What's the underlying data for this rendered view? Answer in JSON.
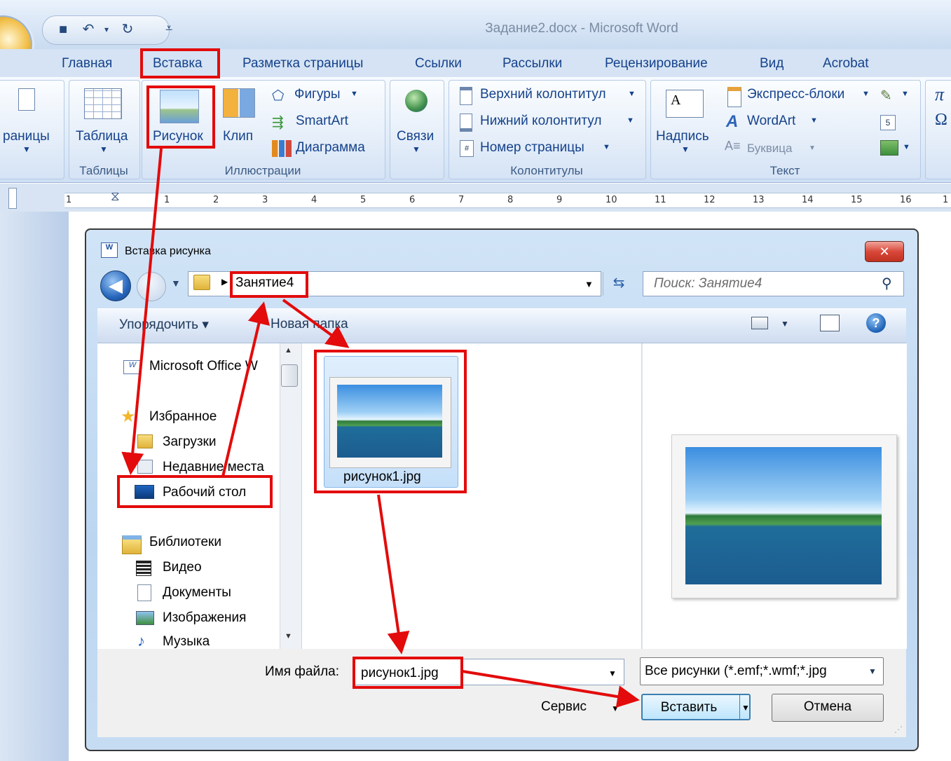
{
  "window": {
    "title": "Задание2.docx - Microsoft Word"
  },
  "tabs": [
    "Главная",
    "Вставка",
    "Разметка страницы",
    "Ссылки",
    "Рассылки",
    "Рецензирование",
    "Вид",
    "Acrobat"
  ],
  "ribbon": {
    "pages_label": "раницы",
    "table_label": "Таблица",
    "tables_group": "Таблицы",
    "picture_label": "Рисунок",
    "clip_label": "Клип",
    "shapes_label": "Фигуры",
    "smartart_label": "SmartArt",
    "chart_label": "Диаграмма",
    "illustrations_group": "Иллюстрации",
    "links_label": "Связи",
    "header_label": "Верхний колонтитул",
    "footer_label": "Нижний колонтитул",
    "pagenum_label": "Номер страницы",
    "headers_group": "Колонтитулы",
    "textbox_label": "Надпись",
    "quickparts_label": "Экспресс-блоки",
    "wordart_label": "WordArt",
    "dropcap_label": "Буквица",
    "text_group": "Текст",
    "pi_symbol": "π",
    "omega_symbol": "Ω"
  },
  "ruler": {
    "numbers": [
      "1",
      "1",
      "2",
      "3",
      "4",
      "5",
      "6",
      "7",
      "8",
      "9",
      "10",
      "11",
      "12",
      "13",
      "14",
      "15",
      "16",
      "1"
    ]
  },
  "dialog": {
    "title": "Вставка рисунка",
    "close": "✕",
    "address": "Занятие4",
    "search_placeholder": "Поиск: Занятие4",
    "organize": "Упорядочить ▾",
    "new_folder": "Новая папка",
    "nav": {
      "msoffice": "Microsoft Office W",
      "favorites": "Избранное",
      "downloads": "Загрузки",
      "recent": "Недавние места",
      "desktop": "Рабочий стол",
      "libraries": "Библиотеки",
      "video": "Видео",
      "documents": "Документы",
      "images": "Изображения",
      "music": "Музыка"
    },
    "file_name_label": "Имя файла:",
    "file_name_value": "рисунок1.jpg",
    "file_item": "рисунок1.jpg",
    "filter": "Все рисунки (*.emf;*.wmf;*.jpg",
    "service": "Сервис",
    "insert": "Вставить",
    "cancel": "Отмена"
  },
  "colors": {
    "highlight": "#e30b0b",
    "accent": "#15428b"
  }
}
